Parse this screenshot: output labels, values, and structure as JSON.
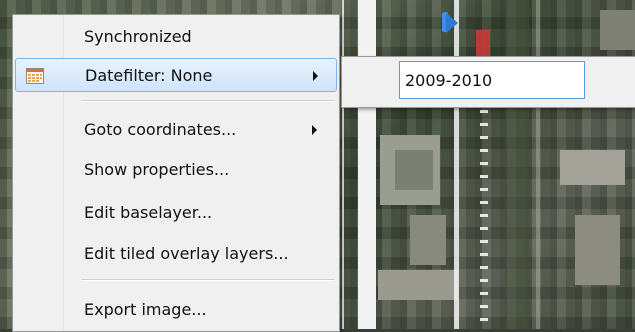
{
  "menu": {
    "items": [
      {
        "label": "Synchronized",
        "submenu": false
      },
      {
        "label": "Datefilter: None",
        "submenu": true,
        "highlighted": true
      },
      {
        "label": "Goto coordinates...",
        "submenu": true
      },
      {
        "label": "Show properties...",
        "submenu": false
      },
      {
        "label": "Edit baselayer...",
        "submenu": false
      },
      {
        "label": "Edit tiled overlay layers...",
        "submenu": false
      },
      {
        "label": "Export image...",
        "submenu": false
      }
    ]
  },
  "submenu": {
    "datefilter_value": "2009-2010"
  },
  "icons": {
    "datefilter": "calendar-icon",
    "submenu_arrow": "chevron-right-icon",
    "timeline_handle": "timeline-handle-icon"
  },
  "colors": {
    "highlight_border": "#7eb4ea",
    "input_border": "#569de5",
    "timeline_handle": "#2a7bd4"
  }
}
